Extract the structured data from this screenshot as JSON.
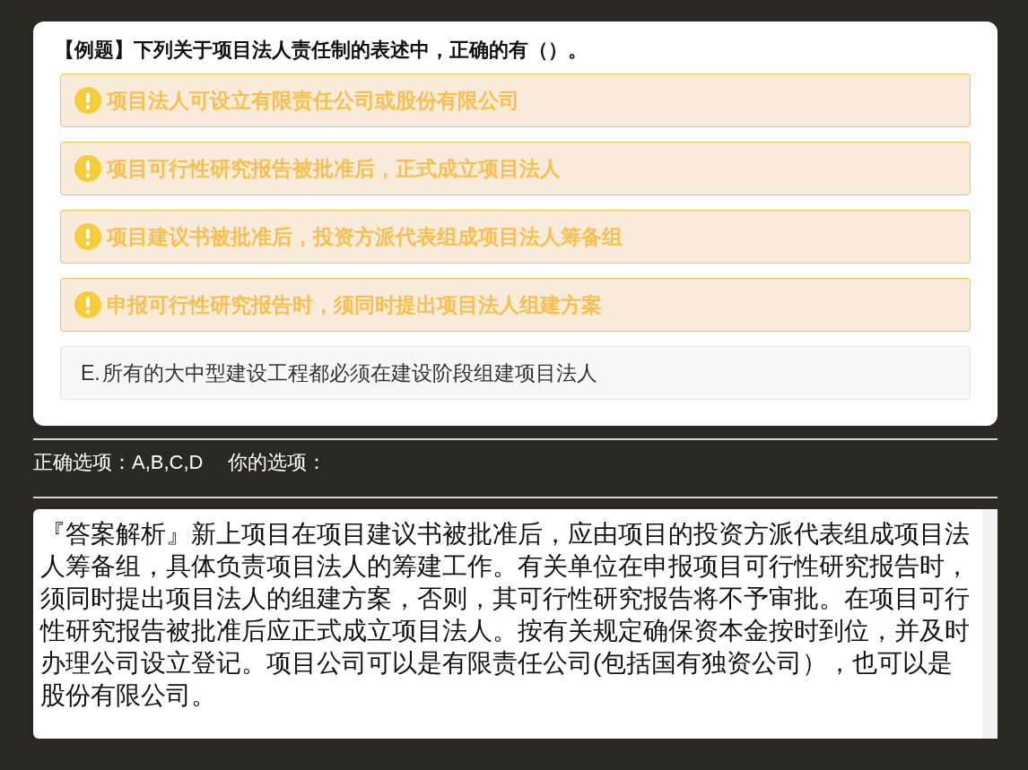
{
  "question": {
    "title": "【例题】下列关于项目法人责任制的表述中，正确的有（）。",
    "options": [
      {
        "text": "项目法人可设立有限责任公司或股份有限公司",
        "correct": true
      },
      {
        "text": "项目可行性研究报告被批准后，正式成立项目法人",
        "correct": true
      },
      {
        "text": "项目建议书被批准后，投资方派代表组成项目法人筹备组",
        "correct": true
      },
      {
        "text": "申报可行性研究报告时，须同时提出项目法人组建方案",
        "correct": true
      },
      {
        "label": "E.",
        "text": "所有的大中型建设工程都必须在建设阶段组建项目法人",
        "correct": false
      }
    ]
  },
  "answer": {
    "correct": "正确选项：A,B,C,D",
    "yours": "你的选项："
  },
  "explanation": "『答案解析』新上项目在项目建议书被批准后，应由项目的投资方派代表组成项目法人筹备组，具体负责项目法人的筹建工作。有关单位在申报项目可行性研究报告时，须同时提出项目法人的组建方案，否则，其可行性研究报告将不予审批。在项目可行性研究报告被批准后应正式成立项目法人。按有关规定确保资本金按时到位，并及时办理公司设立登记。项目公司可以是有限责任公司(包括国有独资公司），也可以是股份有限公司。"
}
